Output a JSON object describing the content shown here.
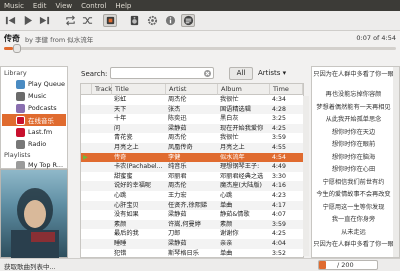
{
  "menu": [
    "Music",
    "Edit",
    "View",
    "Control",
    "Help"
  ],
  "now_playing": {
    "title": "传奇",
    "by_line": "by 李健 from 似水流年",
    "time": "0:07 of 4:54",
    "progress_fraction": 0.024
  },
  "sidebar": {
    "library_header": "Library",
    "items": [
      {
        "label": "Play Queue",
        "icon": "play-queue-icon",
        "color": "#4a8bc2"
      },
      {
        "label": "Music",
        "icon": "music-icon",
        "color": "#6b6b6b"
      },
      {
        "label": "Podcasts",
        "icon": "podcast-icon",
        "color": "#8a6fb0"
      },
      {
        "label": "在线音乐",
        "icon": "online-music-icon",
        "color": "#c8102e"
      },
      {
        "label": "Last.fm",
        "icon": "lastfm-icon",
        "color": "#c8102e"
      },
      {
        "label": "Radio",
        "icon": "radio-icon",
        "color": "#777777"
      }
    ],
    "playlists_header": "Playlists",
    "playlist_items": [
      {
        "label": "My Top R..."
      }
    ]
  },
  "filter": {
    "search_label": "Search:",
    "search_value": "",
    "all_label": "All",
    "artists_label": "Artists"
  },
  "table": {
    "headers": [
      "Track",
      "Title",
      "Artist",
      "Album",
      "Time"
    ],
    "rows": [
      [
        "",
        "彩虹",
        "周杰伦",
        "我很忙",
        "4:34"
      ],
      [
        "",
        "天下",
        "张杰",
        "国语精选辑",
        "4:28"
      ],
      [
        "",
        "十年",
        "陈奕迅",
        "黑白灰",
        "3:25"
      ],
      [
        "",
        "问",
        "梁静茹",
        "现在开始我爱你",
        "4:25"
      ],
      [
        "",
        "青花瓷",
        "周杰伦",
        "我很忙",
        "3:59"
      ],
      [
        "",
        "月亮之上",
        "凤凰传奇",
        "月亮之上",
        "4:55"
      ],
      [
        "",
        "传奇",
        "李健",
        "似水流年",
        "4:54"
      ],
      [
        "",
        "卡农(Pachabel...",
        "纯音乐",
        "理想钢琴王子:",
        "4:49"
      ],
      [
        "",
        "甜蜜蜜",
        "邓丽君",
        "邓丽君经典之选",
        "3:30"
      ],
      [
        "",
        "说好的幸福呢",
        "周杰伦",
        "魔杰座(大陆版)",
        "4:16"
      ],
      [
        "",
        "心跳",
        "王力宏",
        "心跳",
        "4:23"
      ],
      [
        "",
        "心肝宝贝",
        "任贤齐,徐熙娣",
        "单曲",
        "4:17"
      ],
      [
        "",
        "没有如果",
        "梁静茹",
        "静茹&情歌",
        "4:07"
      ],
      [
        "",
        "素颜",
        "许嵩,何曼婷",
        "素颜",
        "3:59"
      ],
      [
        "",
        "最后的我",
        "刀郎",
        "谢谢你",
        "4:25"
      ],
      [
        "",
        "睡睡",
        "梁静茹",
        "亲亲",
        "4:04"
      ],
      [
        "",
        "犯错",
        "斯琴格日乐",
        "单曲",
        "3:52"
      ]
    ],
    "playing_row": 6
  },
  "lyrics": {
    "header": "只因为在人群中多看了你一眼",
    "lines": [
      "再也没能忘掉你容颜",
      "梦想着偶然能有一天再相见",
      "从此我开始孤单思念",
      "想你时你在天边",
      "想你时你在眼前",
      "想你时你在脑海",
      "想你时你在心田",
      "宁愿相信我们前世有约",
      "今生的爱情故事不会再改变",
      "宁愿用这一生等你发现",
      "我一直在你身旁",
      "从未走远",
      "只因为在人群中多看了你一眼"
    ]
  },
  "status": {
    "text": "获取歌曲列表中...",
    "count_label": "/ 200",
    "load_fraction": 0.12
  },
  "colors": {
    "accent": "#e06b2f",
    "menubar": "#3c3b37"
  }
}
